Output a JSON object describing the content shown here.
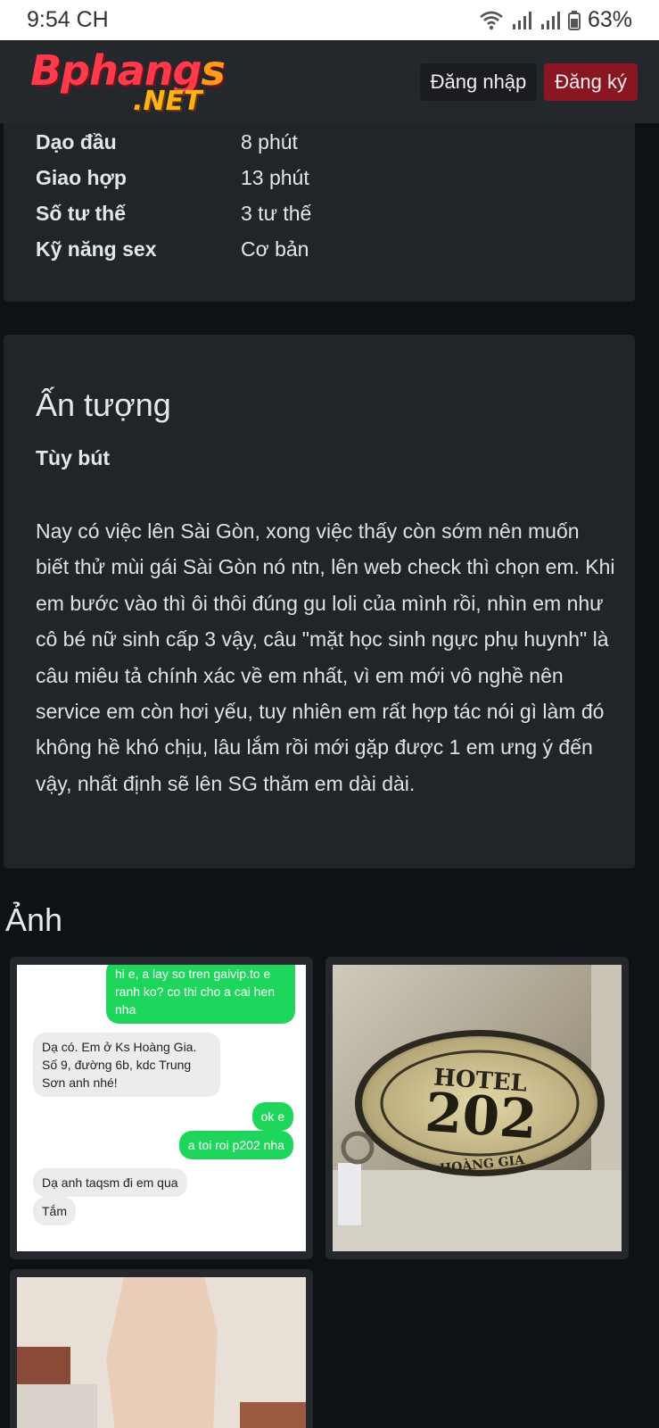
{
  "status_bar": {
    "time": "9:54 CH",
    "battery": "63%",
    "icons": [
      "wifi-icon",
      "signal-icon",
      "signal-icon",
      "battery-icon"
    ]
  },
  "header": {
    "logo_text": "Bphangs",
    "logo_suffix": ".NET",
    "login_label": "Đăng nhập",
    "register_label": "Đăng ký"
  },
  "stats": [
    {
      "label": "Dạo đầu",
      "value": "8 phút"
    },
    {
      "label": "Giao hợp",
      "value": "13 phút"
    },
    {
      "label": "Số tư thế",
      "value": "3 tư thế"
    },
    {
      "label": "Kỹ năng sex",
      "value": "Cơ bản"
    }
  ],
  "impression": {
    "title": "Ấn tượng",
    "subtitle": "Tùy bút",
    "body": "Nay có việc lên Sài Gòn, xong việc thấy còn sớm nên muốn biết thử mùi gái Sài Gòn nó ntn, lên web check thì chọn em. Khi em bước vào thì ôi thôi đúng gu loli của mình rồi, nhìn em như cô bé nữ sinh cấp 3 vậy, câu \"mặt học sinh ngực phụ huynh\" là câu miêu tả chính xác về em nhất, vì em mới vô nghề nên service em còn hơi yếu, tuy nhiên em rất hợp tác nói gì làm đó không hề khó chịu, lâu lắm rồi mới gặp được 1 em ưng ý đến vậy, nhất định sẽ lên SG thăm em dài dài."
  },
  "photos_title": "Ảnh",
  "chat": {
    "m1": "hi e, a lay so tren gaivip.to e ranh ko? co thi cho a cai hen nha",
    "m2": "Dạ có. Em ở Ks Hoàng Gia. Số 9, đường 6b, kdc Trung Sơn anh nhé!",
    "m3": "ok e",
    "m4": "a toi roi p202 nha",
    "m5": "Dạ anh taqsm đi em qua",
    "m6": "Tắm"
  },
  "hotel_tag": {
    "line1": "HOTEL",
    "number": "202",
    "line2": "HOÀNG GIA"
  },
  "colors": {
    "background": "#0f1215",
    "card": "#212429",
    "navbar": "#24272b",
    "register": "#8a1622",
    "logo_red": "#ff3a4a",
    "logo_orange": "#ffb21a"
  }
}
